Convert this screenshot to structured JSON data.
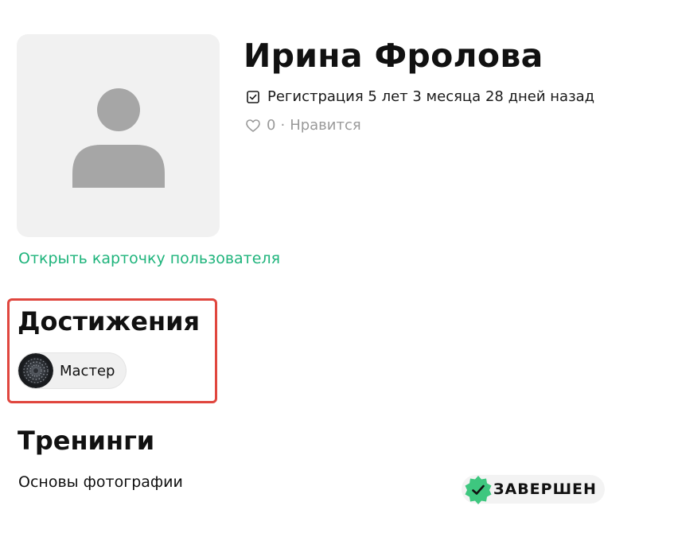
{
  "profile": {
    "name": "Ирина Фролова",
    "registration": "Регистрация 5 лет 3 месяца 28 дней назад",
    "likes_count": "0",
    "likes_separator": "·",
    "likes_label": "Нравится",
    "open_card_link": "Открыть карточку пользователя"
  },
  "achievements": {
    "title": "Достижения",
    "items": [
      {
        "label": "Мастер"
      }
    ]
  },
  "trainings": {
    "title": "Тренинги",
    "items": [
      {
        "name": "Основы фотографии",
        "status": "ЗАВЕРШЕН"
      }
    ]
  },
  "colors": {
    "link": "#1fb47c",
    "highlight": "#e0463e",
    "status_icon": "#3ec77f",
    "avatar_bg": "#f1f1f1",
    "avatar_figure": "#a6a6a6"
  },
  "icons": {
    "registration": "checkbox-icon",
    "likes": "heart-icon",
    "status": "check-badge-icon",
    "avatar": "user-placeholder-icon"
  }
}
